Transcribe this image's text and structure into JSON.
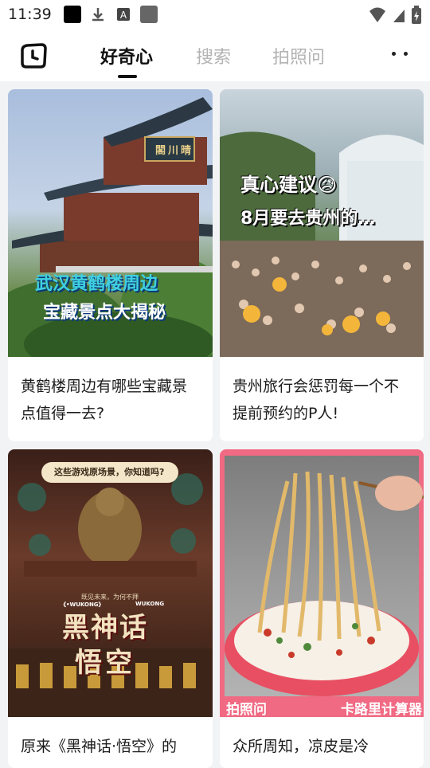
{
  "status": {
    "time": "11:39"
  },
  "tabs": [
    {
      "label": "好奇心",
      "active": true
    },
    {
      "label": "搜索",
      "active": false
    },
    {
      "label": "拍照问",
      "active": false
    }
  ],
  "icons": {
    "logo": "camera-clock-logo",
    "more": "more-dots-icon"
  },
  "cards": [
    {
      "title": "黄鹤楼周边有哪些宝藏景点值得一去?",
      "overlay_lines": [
        "武汉黄鹤楼周边",
        "宝藏景点大揭秘"
      ],
      "sign_text": "閣川晴"
    },
    {
      "title": "贵州旅行会惩罚每一个不提前预约的P人!",
      "overlay_lines": [
        "真心建议😥",
        "8月要去贵州的…"
      ]
    },
    {
      "title": "原来《黑神话·悟空》的",
      "overlay_top": "这些游戏原场景，你知道吗?",
      "caption_small": "既见未来，为何不拜",
      "wukong_tags": [
        "《•WUKONG》",
        "WUKONG"
      ],
      "big_text": [
        "黑神话",
        "悟空"
      ]
    },
    {
      "title": "众所周知，凉皮是冷",
      "badge_left": "拍照问",
      "badge_right": "卡路里计算器"
    }
  ],
  "colors": {
    "accent": "#111111",
    "inactive_tab": "#b3b3b3",
    "badge_pink": "#f06a83"
  }
}
